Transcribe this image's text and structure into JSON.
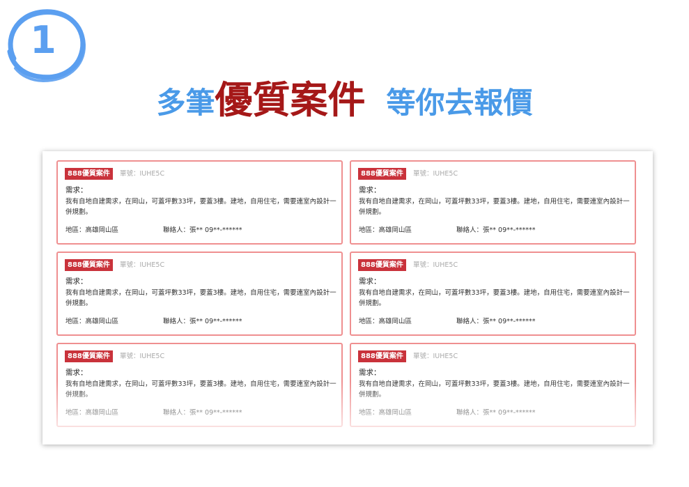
{
  "step": {
    "number": "1"
  },
  "headline": {
    "part1": "多筆",
    "part2": "優質案件",
    "part3": "等你去報價"
  },
  "colors": {
    "accent_blue": "#4a9ae8",
    "accent_red": "#a51818",
    "card_border": "#ef8f90",
    "tag_bg": "#c9323b"
  },
  "cards": [
    {
      "tag": "888優質案件",
      "order": "單號：IUHE5C",
      "need_label": "需求：",
      "need_text": "我有自地自建需求，在岡山，可蓋坪數33坪，要蓋3樓。建地，自用住宅，需要連室內設計一併規劃。",
      "region": "地區：高雄岡山區",
      "contact": "聯絡人：張**  09**-******"
    },
    {
      "tag": "888優質案件",
      "order": "單號：IUHE5C",
      "need_label": "需求：",
      "need_text": "我有自地自建需求，在岡山，可蓋坪數33坪，要蓋3樓。建地，自用住宅，需要連室內設計一併規劃。",
      "region": "地區：高雄岡山區",
      "contact": "聯絡人：張**  09**-******"
    },
    {
      "tag": "888優質案件",
      "order": "單號：IUHE5C",
      "need_label": "需求：",
      "need_text": "我有自地自建需求，在岡山，可蓋坪數33坪，要蓋3樓。建地，自用住宅，需要連室內設計一併規劃。",
      "region": "地區：高雄岡山區",
      "contact": "聯絡人：張**  09**-******"
    },
    {
      "tag": "888優質案件",
      "order": "單號：IUHE5C",
      "need_label": "需求：",
      "need_text": "我有自地自建需求，在岡山，可蓋坪數33坪，要蓋3樓。建地，自用住宅，需要連室內設計一併規劃。",
      "region": "地區：高雄岡山區",
      "contact": "聯絡人：張**  09**-******"
    },
    {
      "tag": "888優質案件",
      "order": "單號：IUHE5C",
      "need_label": "需求：",
      "need_text": "我有自地自建需求，在岡山，可蓋坪數33坪，要蓋3樓。建地，自用住宅，需要連室內設計一併規劃。",
      "region": "地區：高雄岡山區",
      "contact": "聯絡人：張**  09**-******"
    },
    {
      "tag": "888優質案件",
      "order": "單號：IUHE5C",
      "need_label": "需求：",
      "need_text": "我有自地自建需求，在岡山，可蓋坪數33坪，要蓋3樓。建地，自用住宅，需要連室內設計一併規劃。",
      "region": "地區：高雄岡山區",
      "contact": "聯絡人：張**  09**-******"
    }
  ]
}
